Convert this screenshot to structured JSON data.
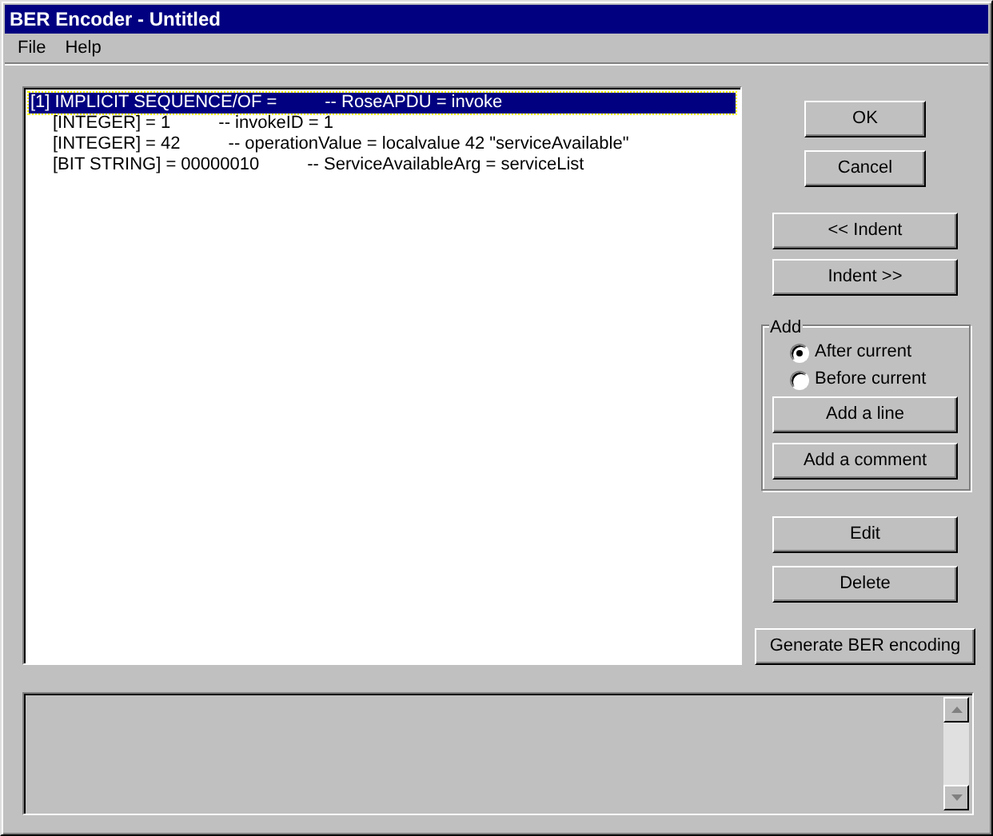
{
  "window": {
    "title": "BER Encoder - Untitled"
  },
  "menu": [
    {
      "label": "File"
    },
    {
      "label": "Help"
    }
  ],
  "encoding_tree": [
    {
      "value": "[1] IMPLICIT SEQUENCE/OF =",
      "comment": "-- RoseAPDU = invoke",
      "selected": true,
      "children": [
        {
          "value": "[INTEGER] = 1",
          "comment": "-- invokeID = 1",
          "selected": false
        },
        {
          "value": "[INTEGER] = 42",
          "comment": "-- operationValue = localvalue 42 \"serviceAvailable\"",
          "selected": false
        },
        {
          "value": "[BIT STRING] = 00000010",
          "comment": "-- ServiceAvailableArg = serviceList",
          "selected": false
        }
      ]
    }
  ],
  "dialog_buttons": [
    "OK",
    "Cancel"
  ],
  "indent_buttons": [
    "<< Indent",
    "Indent >>"
  ],
  "add_group": {
    "title": "Add",
    "options": [
      {
        "label": "After current",
        "selected": true
      },
      {
        "label": "Before current",
        "selected": false
      }
    ],
    "buttons": [
      "Add a line",
      "Add a comment"
    ]
  },
  "edit_buttons": [
    "Edit",
    "Delete"
  ],
  "generate_button": "Generate BER encoding"
}
